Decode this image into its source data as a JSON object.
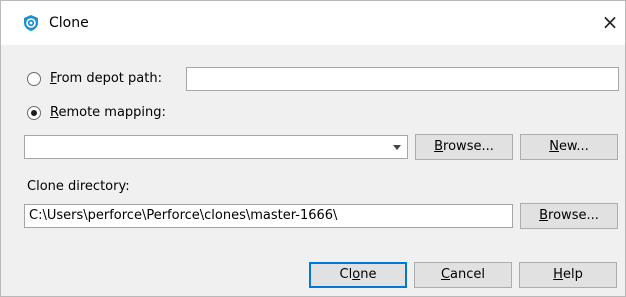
{
  "window": {
    "title": "Clone",
    "close_glyph": "×",
    "icon": "perforce-shield-icon",
    "accent_color": "#1e90d6"
  },
  "depot_path": {
    "label_mnemonic": "F",
    "label_rest": "rom depot path:",
    "selected": false,
    "value": ""
  },
  "remote_mapping": {
    "label_mnemonic": "R",
    "label_rest": "emote mapping:",
    "selected": true,
    "value": "",
    "browse_mnemonic": "B",
    "browse_rest": "rowse...",
    "new_mnemonic": "N",
    "new_rest": "ew..."
  },
  "clone_directory": {
    "label": "Clone directory:",
    "value": "C:\\Users\\perforce\\Perforce\\clones\\master-1666\\",
    "browse_mnemonic": "B",
    "browse_rest": "rowse..."
  },
  "footer": {
    "clone_pre": "Cl",
    "clone_mnemonic": "o",
    "clone_post": "ne",
    "cancel_mnemonic": "C",
    "cancel_rest": "ancel",
    "help_mnemonic": "H",
    "help_rest": "elp"
  }
}
